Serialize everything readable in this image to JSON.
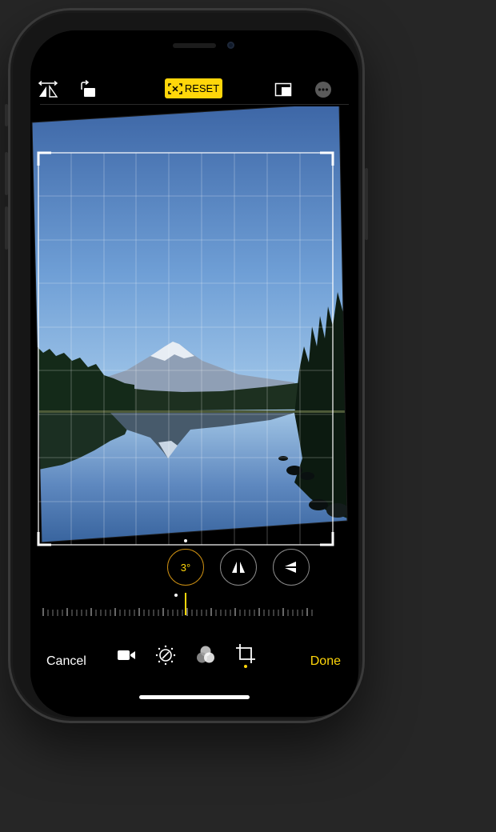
{
  "toolbar": {
    "reset_label": "RESET",
    "icons": [
      "flip-icon",
      "rotate-icon",
      "aspect-ratio-icon",
      "more-icon"
    ]
  },
  "adjust": {
    "straighten_value": "3°"
  },
  "tabs": [
    "video-icon",
    "adjust-icon",
    "filters-icon",
    "crop-icon"
  ],
  "bottom": {
    "cancel_label": "Cancel",
    "done_label": "Done"
  },
  "colors": {
    "accent": "#ffd60a",
    "sky_top": "#3f6aa8",
    "sky_bottom": "#9fc8ec"
  }
}
